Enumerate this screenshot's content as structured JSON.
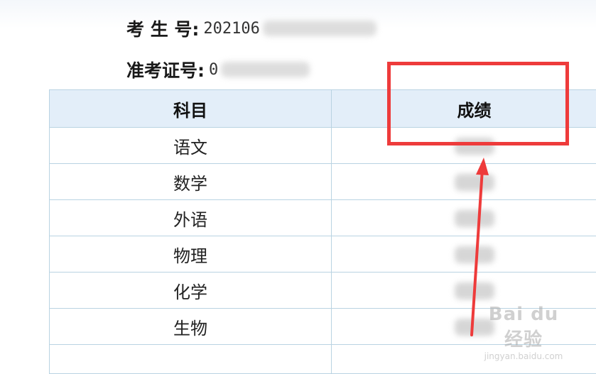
{
  "candidate": {
    "exam_no_label": "考 生 号:",
    "exam_no_value": "202106",
    "admission_label": "准考证号:",
    "admission_value": "0"
  },
  "table": {
    "headers": [
      "科目",
      "成绩"
    ],
    "rows": [
      {
        "subject": "语文"
      },
      {
        "subject": "数学"
      },
      {
        "subject": "外语"
      },
      {
        "subject": "物理"
      },
      {
        "subject": "化学"
      },
      {
        "subject": "生物"
      }
    ]
  },
  "watermark": {
    "logo": "Bai du 经验",
    "url": "jingyan.baidu.com"
  },
  "colors": {
    "highlight": "#ee3b3b",
    "header_bg": "#e3eef9",
    "grid": "#b9d3e2"
  }
}
